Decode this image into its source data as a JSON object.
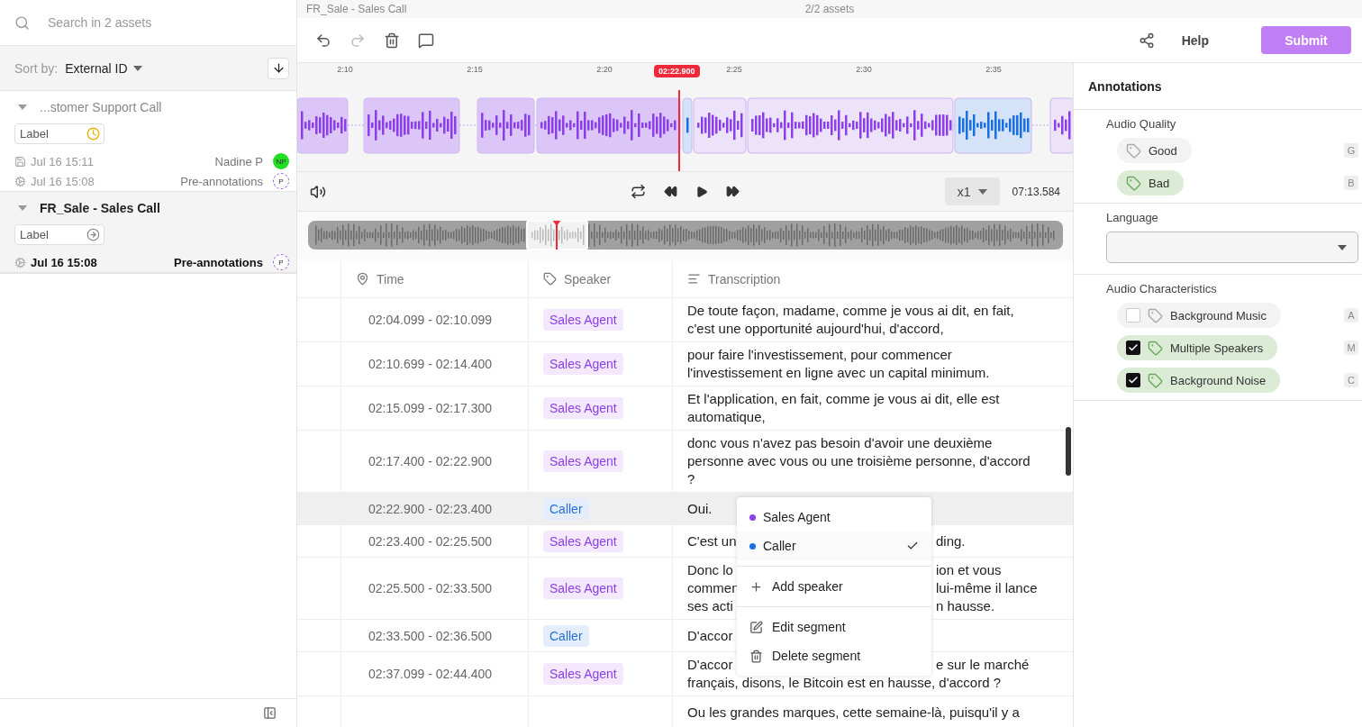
{
  "sidebar": {
    "search": {
      "placeholder": "Search in 2 assets"
    },
    "sort": {
      "label": "Sort by:",
      "value": "External ID"
    },
    "assets": [
      {
        "title": "...stomer Support Call",
        "selected": false,
        "label": {
          "text": "Label",
          "kind": "pending"
        },
        "history": [
          {
            "kind": "saved",
            "date": "Jul 16 15:11",
            "author": "Nadine P",
            "avatar": {
              "kind": "user",
              "initials": "NP",
              "color": "#22dd22"
            }
          },
          {
            "kind": "preannotated",
            "date": "Jul 16 15:08",
            "author": "Pre-annotations",
            "avatar": {
              "kind": "pre",
              "initials": "P"
            }
          }
        ]
      },
      {
        "title": "FR_Sale - Sales Call",
        "selected": true,
        "label": {
          "text": "Label",
          "kind": "next"
        },
        "history": [
          {
            "kind": "preannotated",
            "date": "Jul 16 15:08",
            "author": "Pre-annotations",
            "avatar": {
              "kind": "pre",
              "initials": "P"
            }
          }
        ]
      }
    ]
  },
  "header": {
    "asset_title": "FR_Sale - Sales Call",
    "asset_count": "2/2 assets"
  },
  "toolbar": {
    "help": "Help",
    "submit": "Submit"
  },
  "player": {
    "ticks": [
      "2:10",
      "2:15",
      "2:20",
      "2:25",
      "2:30",
      "2:35"
    ],
    "playhead": "02:22.900",
    "speed": "x1",
    "duration": "07:13.584"
  },
  "table": {
    "columns": [
      "Time",
      "Speaker",
      "Transcription"
    ],
    "rows": [
      {
        "time": "02:04.099 - 02:10.099",
        "speaker": {
          "name": "Sales Agent",
          "kind": "agent"
        },
        "selected": false,
        "lines": [
          {
            "kind": "text",
            "text": "De toute façon, madame, comme je vous ai dit, en fait, c'est une opportunité aujourd'hui, d'accord,"
          }
        ]
      },
      {
        "time": "02:10.699 - 02:14.400",
        "speaker": {
          "name": "Sales Agent",
          "kind": "agent"
        },
        "selected": false,
        "lines": [
          {
            "kind": "text",
            "text": "pour faire l'investissement, pour commencer l'investissement en ligne avec un capital minimum."
          }
        ]
      },
      {
        "time": "02:15.099 - 02:17.300",
        "speaker": {
          "name": "Sales Agent",
          "kind": "agent"
        },
        "selected": false,
        "lines": [
          {
            "kind": "text",
            "text": "Et l'application, en fait, comme je vous ai dit, elle est automatique,"
          }
        ]
      },
      {
        "time": "02:17.400 - 02:22.900",
        "speaker": {
          "name": "Sales Agent",
          "kind": "agent"
        },
        "selected": false,
        "lines": [
          {
            "kind": "text",
            "text": "donc vous n'avez pas besoin d'avoir une deuxième personne avec vous ou une troisième personne, d'accord ?"
          }
        ]
      },
      {
        "time": "02:22.900 - 02:23.400",
        "speaker": {
          "name": "Caller",
          "kind": "caller"
        },
        "selected": true,
        "lines": [
          {
            "kind": "text",
            "text": "Oui."
          }
        ]
      },
      {
        "time": "02:23.400 - 02:25.500",
        "speaker": {
          "name": "Sales Agent",
          "kind": "agent"
        },
        "selected": false,
        "lines": [
          {
            "kind": "split",
            "start": "C'est un",
            "end": "ding."
          }
        ]
      },
      {
        "time": "02:25.500 - 02:33.500",
        "speaker": {
          "name": "Sales Agent",
          "kind": "agent"
        },
        "selected": false,
        "lines": [
          {
            "kind": "split",
            "start": "Donc lo",
            "end": "ion et vous"
          },
          {
            "kind": "split",
            "start": "commen",
            "end": "lui-même il lance"
          },
          {
            "kind": "split",
            "start": "ses acti",
            "end": "n hausse."
          }
        ]
      },
      {
        "time": "02:33.500 - 02:36.500",
        "speaker": {
          "name": "Caller",
          "kind": "caller"
        },
        "selected": false,
        "lines": [
          {
            "kind": "split",
            "start": "D'accor"
          }
        ]
      },
      {
        "time": "02:37.099 - 02:44.400",
        "speaker": {
          "name": "Sales Agent",
          "kind": "agent"
        },
        "selected": false,
        "lines": [
          {
            "kind": "split",
            "start": "D'accor",
            "end": "e sur le marché"
          },
          {
            "kind": "text",
            "text": "français, disons, le Bitcoin est en hausse, d'accord ?"
          }
        ]
      },
      {
        "selected": false,
        "lines": [
          {
            "kind": "text",
            "text": "Ou les grandes marques, cette semaine-là, puisqu'il y a"
          }
        ]
      }
    ]
  },
  "menu": {
    "speakers": [
      {
        "name": "Sales Agent",
        "color": "#8b3fe6",
        "selected": false
      },
      {
        "name": "Caller",
        "color": "#1a6fe0",
        "selected": true
      }
    ],
    "groups": [
      [
        {
          "kind": "add",
          "label": "Add speaker"
        }
      ],
      [
        {
          "kind": "edit",
          "label": "Edit segment"
        },
        {
          "kind": "delete",
          "label": "Delete segment"
        }
      ]
    ]
  },
  "annotations": {
    "title": "Annotations",
    "sections": [
      {
        "kind": "radio",
        "title": "Audio Quality",
        "options": [
          {
            "label": "Good",
            "key": "G",
            "selected": false
          },
          {
            "label": "Bad",
            "key": "B",
            "selected": true
          }
        ]
      },
      {
        "kind": "select",
        "title": "Language"
      },
      {
        "kind": "checkbox",
        "title": "Audio Characteristics",
        "options": [
          {
            "label": "Background Music",
            "key": "A",
            "checked": false
          },
          {
            "label": "Multiple Speakers",
            "key": "M",
            "checked": true
          },
          {
            "label": "Background Noise",
            "key": "C",
            "checked": true
          }
        ]
      }
    ]
  }
}
